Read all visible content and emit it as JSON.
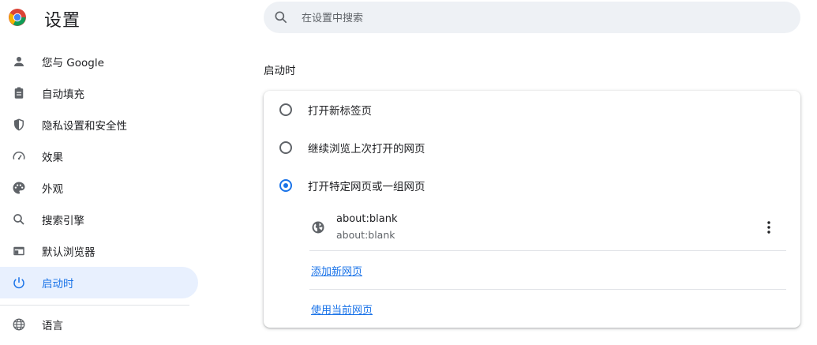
{
  "header": {
    "title": "设置",
    "search_placeholder": "在设置中搜索"
  },
  "colors": {
    "accent": "#1a73e8",
    "active_bg": "#e8f0fe",
    "search_bg": "#eef1f5",
    "text": "#202124",
    "secondary_text": "#5f6368"
  },
  "sidebar": {
    "items": [
      {
        "label": "您与 Google",
        "icon": "person-icon"
      },
      {
        "label": "自动填充",
        "icon": "clipboard-icon"
      },
      {
        "label": "隐私设置和安全性",
        "icon": "shield-icon"
      },
      {
        "label": "效果",
        "icon": "speedometer-icon"
      },
      {
        "label": "外观",
        "icon": "palette-icon"
      },
      {
        "label": "搜索引擎",
        "icon": "search-icon"
      },
      {
        "label": "默认浏览器",
        "icon": "browser-icon"
      },
      {
        "label": "启动时",
        "icon": "power-icon",
        "active": true
      },
      {
        "label": "语言",
        "icon": "globe-icon"
      }
    ]
  },
  "main": {
    "section_title": "启动时",
    "options": [
      {
        "label": "打开新标签页",
        "checked": false
      },
      {
        "label": "继续浏览上次打开的网页",
        "checked": false
      },
      {
        "label": "打开特定网页或一组网页",
        "checked": true
      }
    ],
    "page_entry": {
      "title": "about:blank",
      "url": "about:blank"
    },
    "add_page_link": "添加新网页",
    "use_current_link": "使用当前网页"
  }
}
